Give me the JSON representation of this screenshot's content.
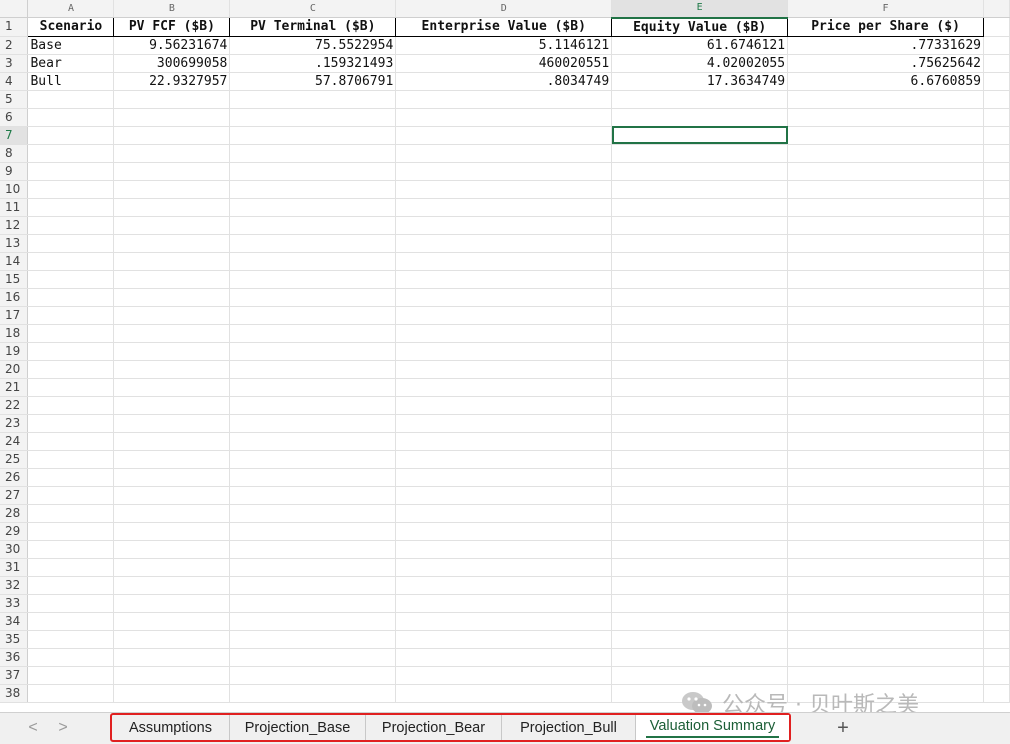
{
  "columns": [
    "A",
    "B",
    "C",
    "D",
    "E",
    "F"
  ],
  "active_column": "E",
  "active_row": 7,
  "headers": [
    "Scenario",
    "PV FCF ($B)",
    "PV Terminal ($B)",
    "Enterprise Value ($B)",
    "Equity Value ($B)",
    "Price per Share ($)"
  ],
  "rows": [
    [
      "Base",
      "9.56231674",
      "75.5522954",
      "5.1146121",
      "61.6746121",
      ".77331629"
    ],
    [
      "Bear",
      "300699058",
      ".159321493",
      "460020551",
      "4.02002055",
      ".75625642"
    ],
    [
      "Bull",
      "22.9327957",
      "57.8706791",
      ".8034749",
      "17.3634749",
      "6.6760859"
    ]
  ],
  "row_count": 38,
  "tabs": [
    "Assumptions",
    "Projection_Base",
    "Projection_Bear",
    "Projection_Bull",
    "Valuation Summary"
  ],
  "active_tab": "Valuation Summary",
  "nav": {
    "prev": "<",
    "next": ">"
  },
  "add_sheet_label": "+",
  "watermark": "公众号 · 贝叶斯之美"
}
